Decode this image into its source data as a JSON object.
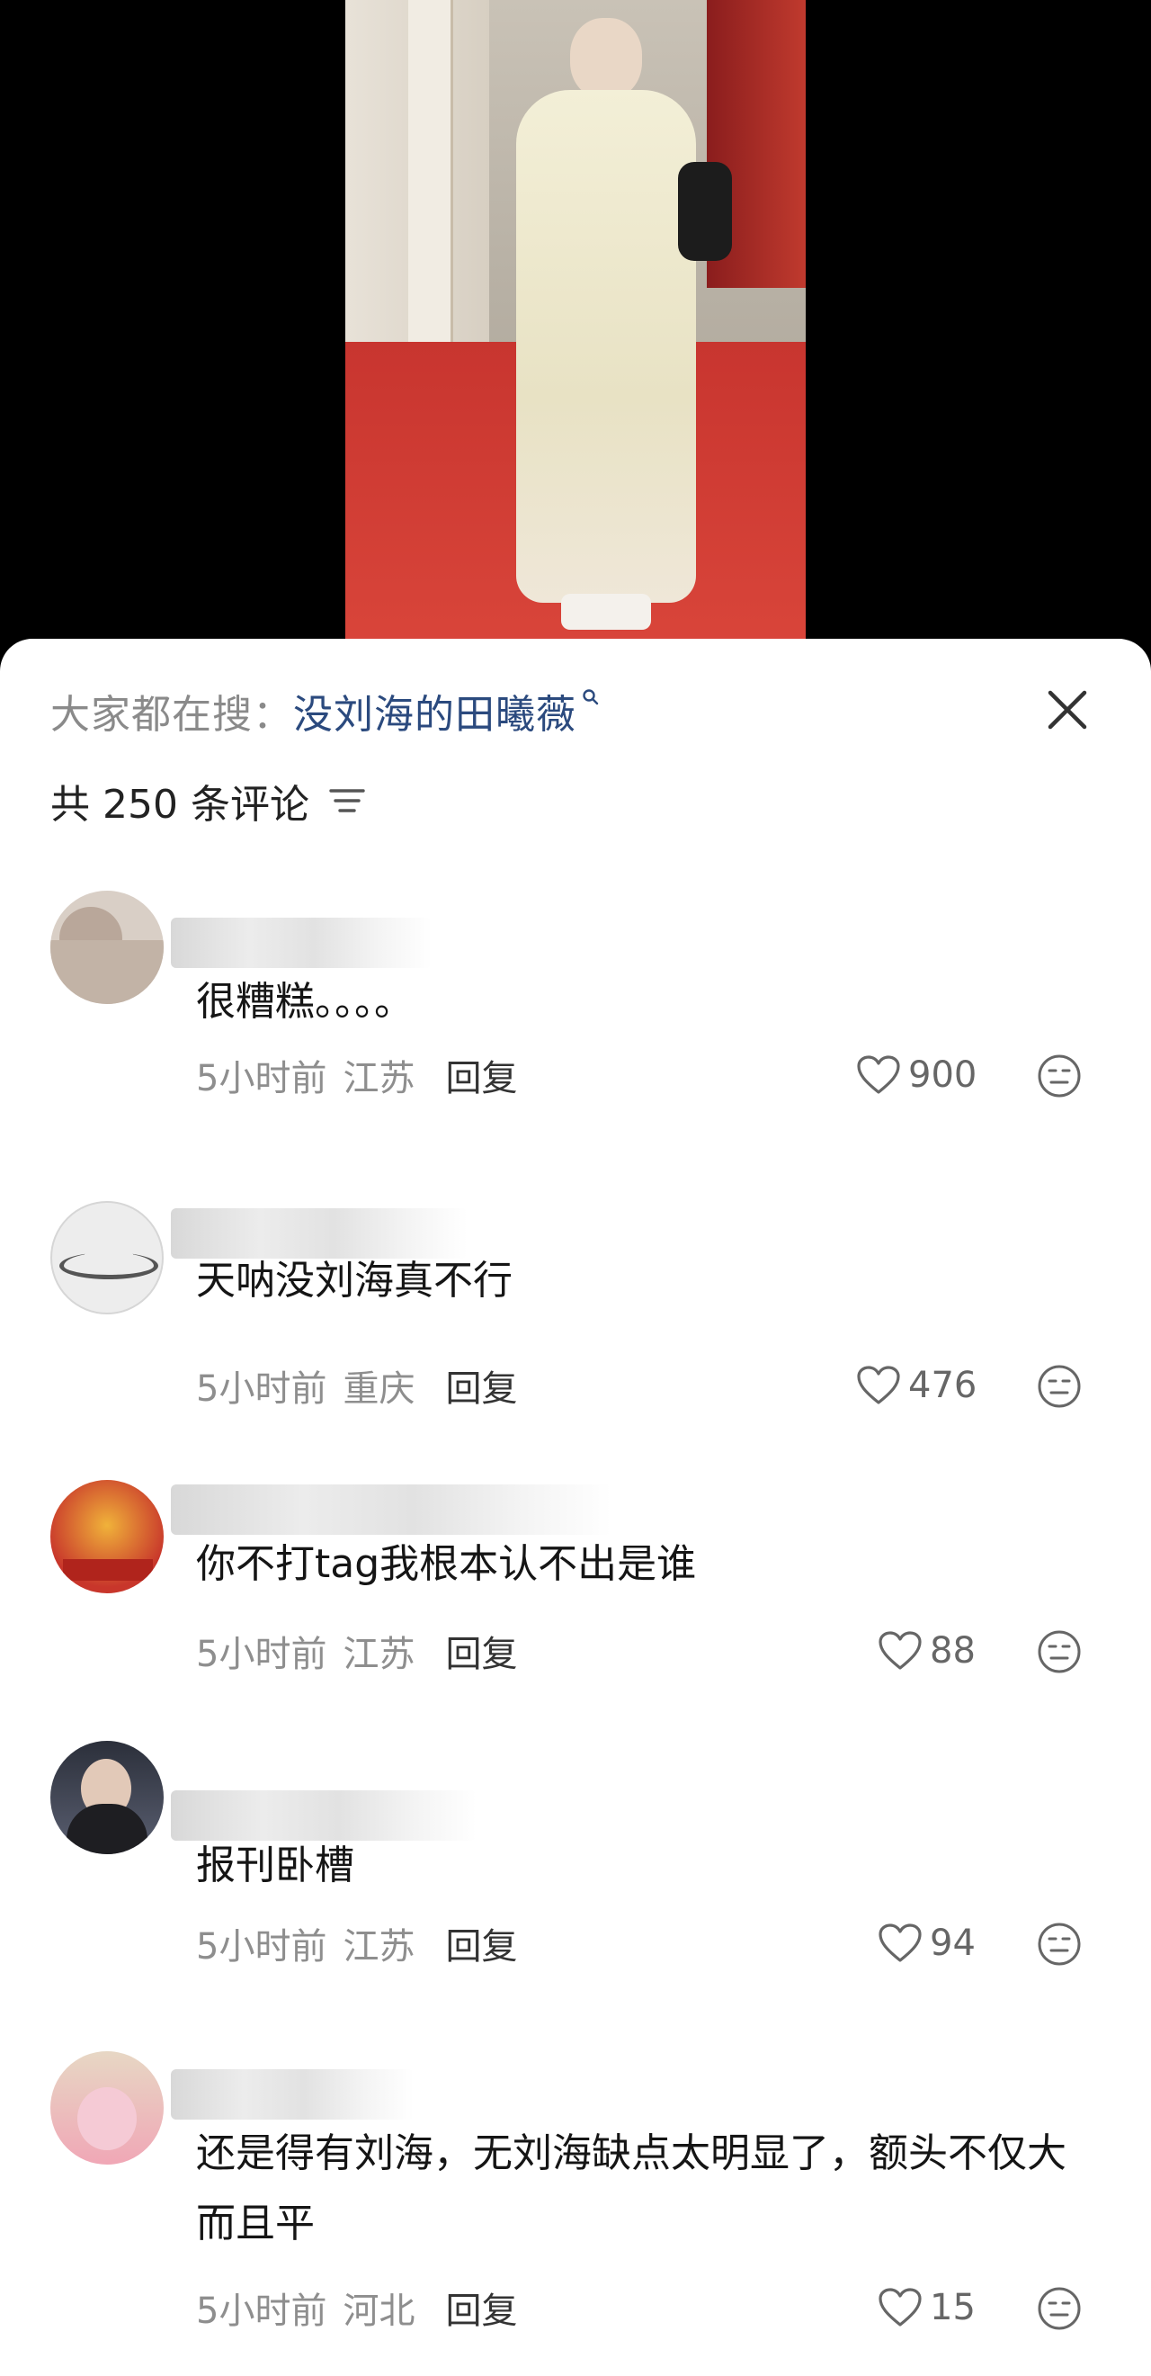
{
  "search_hint": {
    "prefix": "大家都在搜：",
    "keyword": "没刘海的田曦薇"
  },
  "comments_header": {
    "count_text": "共 250 条评论"
  },
  "comments": [
    {
      "text": "很糟糕。。。。",
      "time": "5小时前",
      "location": "江苏",
      "reply_label": "回复",
      "likes": "900"
    },
    {
      "text": "天呐没刘海真不行",
      "time": "5小时前",
      "location": "重庆",
      "reply_label": "回复",
      "likes": "476"
    },
    {
      "text": "你不打tag我根本认不出是谁",
      "time": "5小时前",
      "location": "江苏",
      "reply_label": "回复",
      "likes": "88"
    },
    {
      "text": "报刊卧槽",
      "time": "5小时前",
      "location": "江苏",
      "reply_label": "回复",
      "likes": "94"
    },
    {
      "text": "还是得有刘海，无刘海缺点太明显了，额头不仅大而且平",
      "time": "5小时前",
      "location": "河北",
      "reply_label": "回复",
      "likes": "15"
    }
  ],
  "icons": {
    "close": "close-icon",
    "sort": "sort-icon",
    "like": "heart-outline-icon",
    "dislike": "meh-face-icon",
    "search": "search-icon"
  },
  "colors": {
    "keyword": "#2b4a7e",
    "meta": "#8e8e8e",
    "panel_bg": "#ffffff"
  }
}
